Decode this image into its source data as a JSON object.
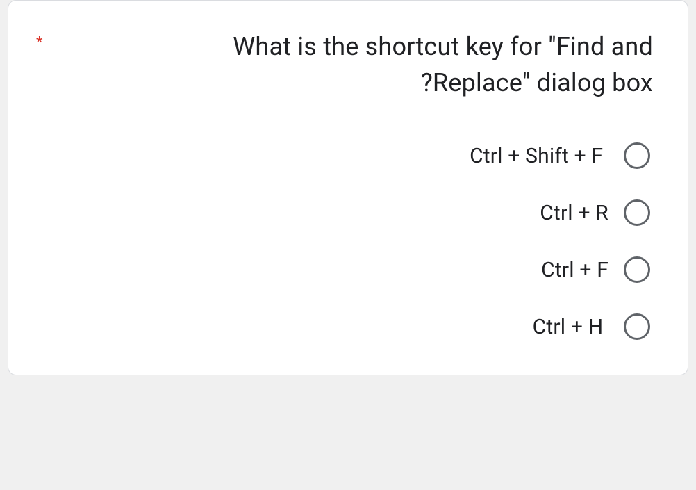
{
  "question": {
    "required_marker": "*",
    "text": "What is the shortcut key for \"Find and Replace\" dialog box?",
    "text_display_line1": "What is the shortcut key for \"Find and",
    "text_display_line2": "?Replace\" dialog box"
  },
  "options": [
    {
      "label": "‫ Ctrl + Shift + F"
    },
    {
      "label": "Ctrl + R"
    },
    {
      "label": "Ctrl + F"
    },
    {
      "label": "‫ Ctrl + H"
    }
  ]
}
